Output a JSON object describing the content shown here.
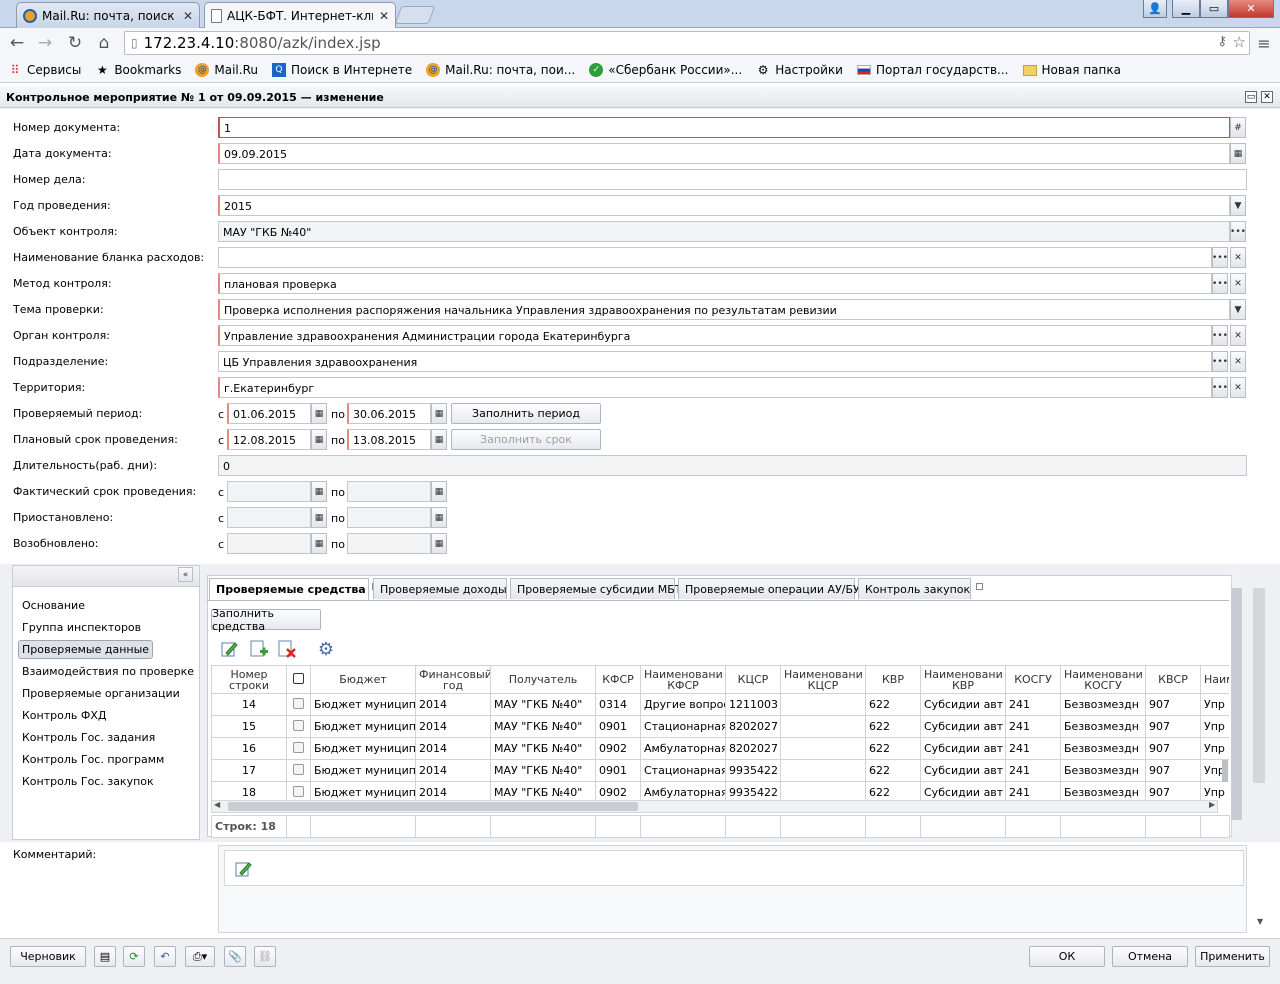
{
  "browser": {
    "tabs": [
      {
        "title": "Mail.Ru: почта, поиск в и",
        "close": "✕"
      },
      {
        "title": "АЦК-БФТ. Интернет-клие",
        "close": "✕"
      }
    ],
    "url_host": "172.23.4.10",
    "url_rest": ":8080/azk/index.jsp",
    "bookmarks": [
      "Сервисы",
      "Bookmarks",
      "Mail.Ru",
      "Поиск в Интернете",
      "Mail.Ru: почта, пои...",
      "«Сбербанк России»...",
      "Настройки",
      "Портал государств...",
      "Новая папка"
    ]
  },
  "window": {
    "title": "Контрольное мероприятие № 1 от 09.09.2015 — изменение"
  },
  "form": {
    "doc_number_label": "Номер документа:",
    "doc_number_value": "1",
    "doc_date_label": "Дата документа:",
    "doc_date_value": "09.09.2015",
    "case_number_label": "Номер дела:",
    "case_number_value": "",
    "year_label": "Год проведения:",
    "year_value": "2015",
    "object_label": "Объект контроля:",
    "object_value": "МАУ \"ГКБ №40\"",
    "blank_label": "Наименование бланка расходов:",
    "blank_value": "",
    "method_label": "Метод контроля:",
    "method_value": "плановая проверка",
    "theme_label": "Тема проверки:",
    "theme_value": "Проверка исполнения распоряжения начальника Управления здравоохранения по результатам ревизии",
    "organ_label": "Орган контроля:",
    "organ_value": "Управление здравоохранения Администрации города Екатеринбурга",
    "division_label": "Подразделение:",
    "division_value": "ЦБ Управления здравоохранения",
    "territory_label": "Территория:",
    "territory_value": "г.Екатеринбург",
    "period_label": "Проверяемый период:",
    "period_from": "01.06.2015",
    "period_to": "30.06.2015",
    "plan_label": "Плановый срок проведения:",
    "plan_from": "12.08.2015",
    "plan_to": "13.08.2015",
    "duration_label": "Длительность(раб. дни):",
    "duration_value": "0",
    "fact_label": "Фактический срок проведения:",
    "suspended_label": "Приостановлено:",
    "resumed_label": "Возобновлено:",
    "from_word": "с",
    "to_word": "по",
    "fill_period": "Заполнить период",
    "fill_term": "Заполнить срок",
    "comment_label": "Комментарий:"
  },
  "nav": {
    "items": [
      "Основание",
      "Группа инспекторов",
      "Проверяемые данные",
      "Взаимодействия по проверке",
      "Проверяемые организации",
      "Контроль ФХД",
      "Контроль Гос. задания",
      "Контроль Гос. программ",
      "Контроль Гос. закупок"
    ],
    "selected": "Проверяемые данные"
  },
  "tabs": [
    "Проверяемые средства",
    "Проверяемые доходы",
    "Проверяемые субсидии МБТ",
    "Проверяемые операции АУ/БУ",
    "Контроль закупок"
  ],
  "fill_funds": "Заполнить средства",
  "grid": {
    "headers": [
      "Номер строки",
      "",
      "Бюджет",
      "Финансовый год",
      "Получатель",
      "КФСР",
      "Наименовани КФСР",
      "КЦСР",
      "Наименовани КЦСР",
      "КВР",
      "Наименовани КВР",
      "КОСГУ",
      "Наименовани КОСГУ",
      "КВСР",
      "Наим"
    ],
    "rows": [
      [
        "14",
        "",
        "Бюджет муниципа",
        "2014",
        "МАУ \"ГКБ №40\"",
        "0314",
        "Другие вопрос",
        "1211003",
        "",
        "622",
        "Субсидии авт",
        "241",
        "Безвозмездн",
        "907",
        "Упр"
      ],
      [
        "15",
        "",
        "Бюджет муниципа",
        "2014",
        "МАУ \"ГКБ №40\"",
        "0901",
        "Стационарная",
        "8202027",
        "",
        "622",
        "Субсидии авт",
        "241",
        "Безвозмездн",
        "907",
        "Упр"
      ],
      [
        "16",
        "",
        "Бюджет муниципа",
        "2014",
        "МАУ \"ГКБ №40\"",
        "0902",
        "Амбулаторная",
        "8202027",
        "",
        "622",
        "Субсидии авт",
        "241",
        "Безвозмездн",
        "907",
        "Упр"
      ],
      [
        "17",
        "",
        "Бюджет муниципа",
        "2014",
        "МАУ \"ГКБ №40\"",
        "0901",
        "Стационарная",
        "9935422",
        "",
        "622",
        "Субсидии авт",
        "241",
        "Безвозмездн",
        "907",
        "Упр"
      ],
      [
        "18",
        "",
        "Бюджет муниципа",
        "2014",
        "МАУ \"ГКБ №40\"",
        "0902",
        "Амбулаторная",
        "9935422",
        "",
        "622",
        "Субсидии авт",
        "241",
        "Безвозмездн",
        "907",
        "Упр"
      ]
    ],
    "footer": "Строк: 18"
  },
  "bottom": {
    "draft": "Черновик",
    "ok": "ОК",
    "cancel": "Отмена",
    "apply": "Применить"
  }
}
